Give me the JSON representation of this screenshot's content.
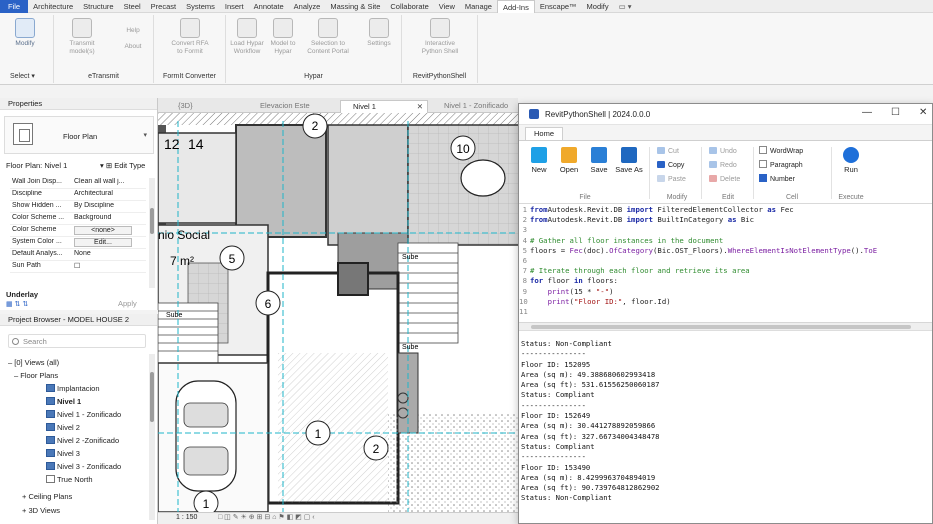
{
  "menu": {
    "file": "File",
    "items": [
      "Architecture",
      "Structure",
      "Steel",
      "Precast",
      "Systems",
      "Insert",
      "Annotate",
      "Analyze",
      "Massing & Site",
      "Collaborate",
      "View",
      "Manage",
      "Add-Ins",
      "Enscape™",
      "Modify"
    ],
    "active": "Add-Ins",
    "extra": "▭ ▾"
  },
  "ribbon": {
    "buttons": [
      {
        "label": "Modify"
      },
      {
        "label": "Transmit model(s)"
      },
      {
        "label": "Help"
      },
      {
        "label": "About"
      },
      {
        "label": "Convert RFA to Formit"
      },
      {
        "label": "Load Hypar Workflow"
      },
      {
        "label": "Model to Hypar"
      },
      {
        "label": "Selection to Content Portal"
      },
      {
        "label": "Settings"
      },
      {
        "label": "Interactive Python Shell"
      }
    ],
    "groups": {
      "select": "Select ▾",
      "etransmit": "eTransmit",
      "formit": "FormIt Converter",
      "hypar": "Hypar",
      "rps": "RevitPythonShell"
    }
  },
  "properties": {
    "title": "Properties",
    "type_name": "Floor Plan",
    "instance": "Floor Plan: Nivel 1",
    "edit_type": "Edit Type",
    "rows": [
      {
        "k": "Wall Join Disp...",
        "v": "Clean all wall j..."
      },
      {
        "k": "Discipline",
        "v": "Architectural"
      },
      {
        "k": "Show Hidden ...",
        "v": "By Discipline"
      },
      {
        "k": "Color Scheme ...",
        "v": "Background"
      },
      {
        "k": "Color Scheme",
        "v": "<none>",
        "btn": true
      },
      {
        "k": "System Color ...",
        "v": "Edit...",
        "btn": true
      },
      {
        "k": "Default Analys...",
        "v": "None"
      },
      {
        "k": "Sun Path",
        "v": "☐"
      }
    ],
    "underlay": "Underlay",
    "apply": "Apply"
  },
  "browser": {
    "title": "Project Browser - MODEL HOUSE 2",
    "search_placeholder": "Search",
    "nodes": [
      {
        "label": "– [0] Views (all)",
        "indent": 0
      },
      {
        "label": "– Floor Plans",
        "indent": 1
      },
      {
        "label": "Implantacion",
        "indent": 3,
        "icon": true
      },
      {
        "label": "Nivel 1",
        "indent": 3,
        "icon": true,
        "bold": true
      },
      {
        "label": "Nivel 1 - Zonificado",
        "indent": 3,
        "icon": true
      },
      {
        "label": "Nivel 2",
        "indent": 3,
        "icon": true
      },
      {
        "label": "Nivel 2 -Zonificado",
        "indent": 3,
        "icon": true
      },
      {
        "label": "Nivel 3",
        "indent": 3,
        "icon": true
      },
      {
        "label": "Nivel 3 - Zonificado",
        "indent": 3,
        "icon": true
      },
      {
        "label": "True North",
        "indent": 3,
        "icon": true
      },
      {
        "label": "+ Ceiling Plans",
        "indent": 1
      },
      {
        "label": "+ 3D Views",
        "indent": 1
      }
    ]
  },
  "view_tabs": [
    {
      "label": "{3D}"
    },
    {
      "label": "Elevacion Este"
    },
    {
      "label": "Nivel 1",
      "active": true,
      "close": "✕"
    },
    {
      "label": "Nivel 1 - Zonificado"
    }
  ],
  "drawing": {
    "labels": {
      "a": "2",
      "b": "12",
      "c": "14",
      "d": "10",
      "e": "nio Social",
      "f": "7 m²",
      "g": "5",
      "h": "6",
      "i": "Sube",
      "j": "Sube",
      "k": "Sube",
      "l": "1",
      "m": "2",
      "n": "1"
    },
    "scale": "1 : 150"
  },
  "rps": {
    "title": "RevitPythonShell | 2024.0.0.0",
    "tab": "Home",
    "file_buttons": [
      "New",
      "Open",
      "Save",
      "Save As"
    ],
    "modify_items": [
      "Cut",
      "Copy",
      "Paste"
    ],
    "edit_items": [
      "Undo",
      "Redo",
      "Delete"
    ],
    "cell_items": [
      "WordWrap",
      "Paragraph",
      "Number"
    ],
    "run": "Run",
    "groups": {
      "file": "File",
      "modify": "Modify",
      "edit": "Edit",
      "cell": "Cell",
      "execute": "Execute"
    },
    "window_controls": {
      "min": "—",
      "max": "☐",
      "close": "✕"
    },
    "code": [
      {
        "n": "1",
        "segs": [
          [
            "kw",
            "from"
          ],
          [
            "",
            "Autodesk.Revit.DB "
          ],
          [
            "kw",
            "import"
          ],
          [
            "",
            " FilteredElementCollector "
          ],
          [
            "kw",
            "as"
          ],
          [
            "",
            " Fec"
          ]
        ]
      },
      {
        "n": "2",
        "segs": [
          [
            "kw",
            "from"
          ],
          [
            "",
            "Autodesk.Revit.DB "
          ],
          [
            "kw",
            "import"
          ],
          [
            "",
            " BuiltInCategory "
          ],
          [
            "kw",
            "as"
          ],
          [
            "",
            " Bic"
          ]
        ]
      },
      {
        "n": "3",
        "segs": []
      },
      {
        "n": "4",
        "segs": [
          [
            "cm",
            "# Gather all floor instances in the document"
          ]
        ]
      },
      {
        "n": "5",
        "segs": [
          [
            "",
            "floors = "
          ],
          [
            "fn",
            "Fec"
          ],
          [
            "",
            "(doc)."
          ],
          [
            "fn",
            "OfCategory"
          ],
          [
            "",
            "(Bic.OST_Floors)."
          ],
          [
            "fn",
            "WhereElementIsNotElementType"
          ],
          [
            "",
            "()."
          ],
          [
            "fn",
            "ToE"
          ]
        ]
      },
      {
        "n": "6",
        "segs": []
      },
      {
        "n": "7",
        "segs": [
          [
            "cm",
            "# Iterate through each floor and retrieve its area"
          ]
        ]
      },
      {
        "n": "8",
        "segs": [
          [
            "kw",
            "for"
          ],
          [
            "",
            " floor "
          ],
          [
            "kw",
            "in"
          ],
          [
            "",
            " floors:"
          ]
        ]
      },
      {
        "n": "9",
        "segs": [
          [
            "",
            "    "
          ],
          [
            "fn",
            "print"
          ],
          [
            "",
            "(15 * "
          ],
          [
            "st",
            "\"-\""
          ],
          [
            "",
            ")"
          ]
        ]
      },
      {
        "n": "10",
        "segs": [
          [
            "",
            "    "
          ],
          [
            "fn",
            "print"
          ],
          [
            "",
            "("
          ],
          [
            "st",
            "\"Floor ID:\""
          ],
          [
            "",
            ", floor.Id)"
          ]
        ]
      },
      {
        "n": "11",
        "segs": []
      }
    ],
    "output": [
      "Status: Non-Compliant",
      "---------------",
      "Floor ID: 152095",
      "Area (sq m): 49.388680602993418",
      "Area (sq ft): 531.61556250060187",
      "Status: Compliant",
      "---------------",
      "Floor ID: 152649",
      "Area (sq m): 30.441278892059866",
      "Area (sq ft): 327.66734004348478",
      "Status: Compliant",
      "---------------",
      "Floor ID: 153490",
      "Area (sq m): 8.4299963704894019",
      "Area (sq ft): 90.739764812862902",
      "Status: Non-Compliant"
    ]
  }
}
